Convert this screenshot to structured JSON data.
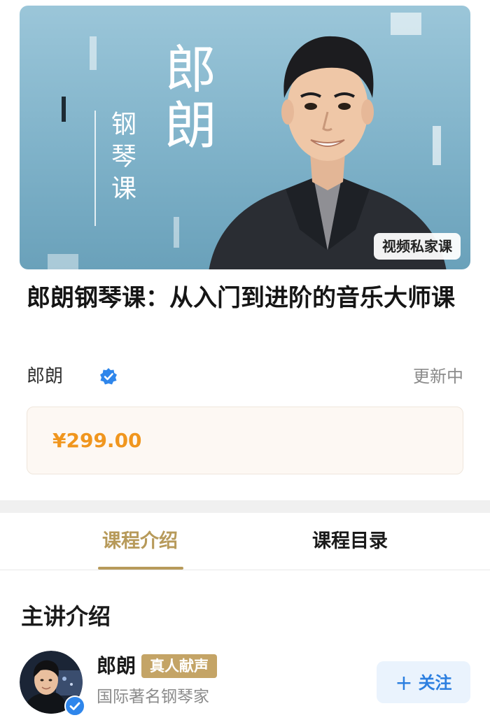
{
  "banner": {
    "big_text": "郎朗",
    "small_text": "钢琴课",
    "tag": "视频私家课"
  },
  "course": {
    "title": "郎朗钢琴课：从入门到进阶的音乐大师课",
    "author": "郎朗",
    "status": "更新中",
    "price": "¥299.00"
  },
  "tabs": [
    {
      "label": "课程介绍",
      "active": true
    },
    {
      "label": "课程目录",
      "active": false
    }
  ],
  "lecturer_section": {
    "title": "主讲介绍",
    "name": "郎朗",
    "badge": "真人献声",
    "description": "国际著名钢琴家",
    "follow_label": "关注",
    "follow_icon": "plus-icon"
  },
  "colors": {
    "accent_gold": "#b79a5a",
    "price_orange": "#f0961e",
    "follow_blue": "#2c7fe0",
    "verified_blue": "#2f86eb"
  }
}
